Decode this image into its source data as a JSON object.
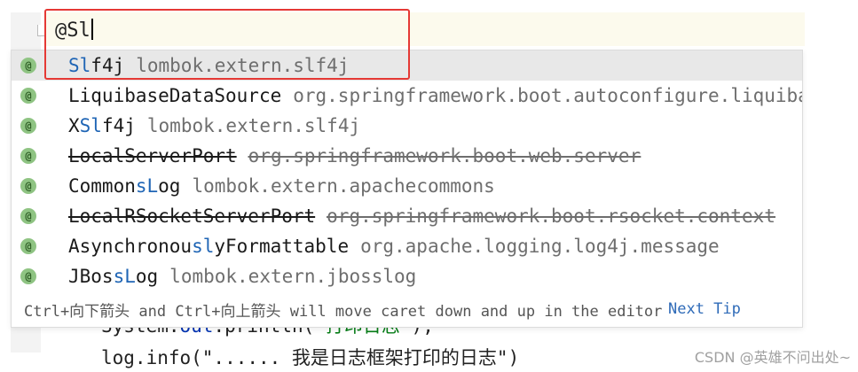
{
  "editor": {
    "typed_text": "@Sl",
    "code_lines": [
      {
        "prefix": "System.",
        "obj": "out",
        "mid": ".println(",
        "str": "\"打印日志\"",
        "suffix": ");"
      },
      {
        "text": "log.info(\"...... 我是日志框架打印的日志\")"
      }
    ]
  },
  "completion": {
    "items": [
      {
        "pre": "",
        "hl": "Sl",
        "post": "f4j",
        "pkg": "lombok.extern.slf4j",
        "deprecated": false,
        "selected": true
      },
      {
        "pre": "Liquiba",
        "hl": "",
        "post": "seDataSource",
        "pkg": "org.springframework.boot.autoconfigure.liquibase",
        "deprecated": false,
        "selected": false
      },
      {
        "pre": "X",
        "hl": "Sl",
        "post": "f4j",
        "pkg": "lombok.extern.slf4j",
        "deprecated": false,
        "selected": false
      },
      {
        "pre": "LocalServerPort",
        "hl": "",
        "post": "",
        "pkg": "org.springframework.boot.web.server",
        "deprecated": true,
        "selected": false
      },
      {
        "pre": "Common",
        "hl": "sL",
        "post": "og",
        "pkg": "lombok.extern.apachecommons",
        "deprecated": false,
        "selected": false
      },
      {
        "pre": "LocalRSocketServerPort",
        "hl": "",
        "post": "",
        "pkg": "org.springframework.boot.rsocket.context",
        "deprecated": true,
        "selected": false
      },
      {
        "pre": "Asynchronou",
        "hl": "sl",
        "post": "yFormattable",
        "pkg": "org.apache.logging.log4j.message",
        "deprecated": false,
        "selected": false
      },
      {
        "pre": "JBos",
        "hl": "sL",
        "post": "og",
        "pkg": "lombok.extern.jbosslog",
        "deprecated": false,
        "selected": false
      }
    ],
    "icon_glyph": "@",
    "tip_text": "Ctrl+向下箭头 and Ctrl+向上箭头 will move caret down and up in the editor",
    "tip_link": "Next Tip"
  },
  "watermark": "CSDN @英雄不问出处~",
  "colors": {
    "highlight": "#1f65b5",
    "selection_bg": "#e8e8e8",
    "annotation_icon": "#8fc483",
    "red_box": "#e53935"
  }
}
